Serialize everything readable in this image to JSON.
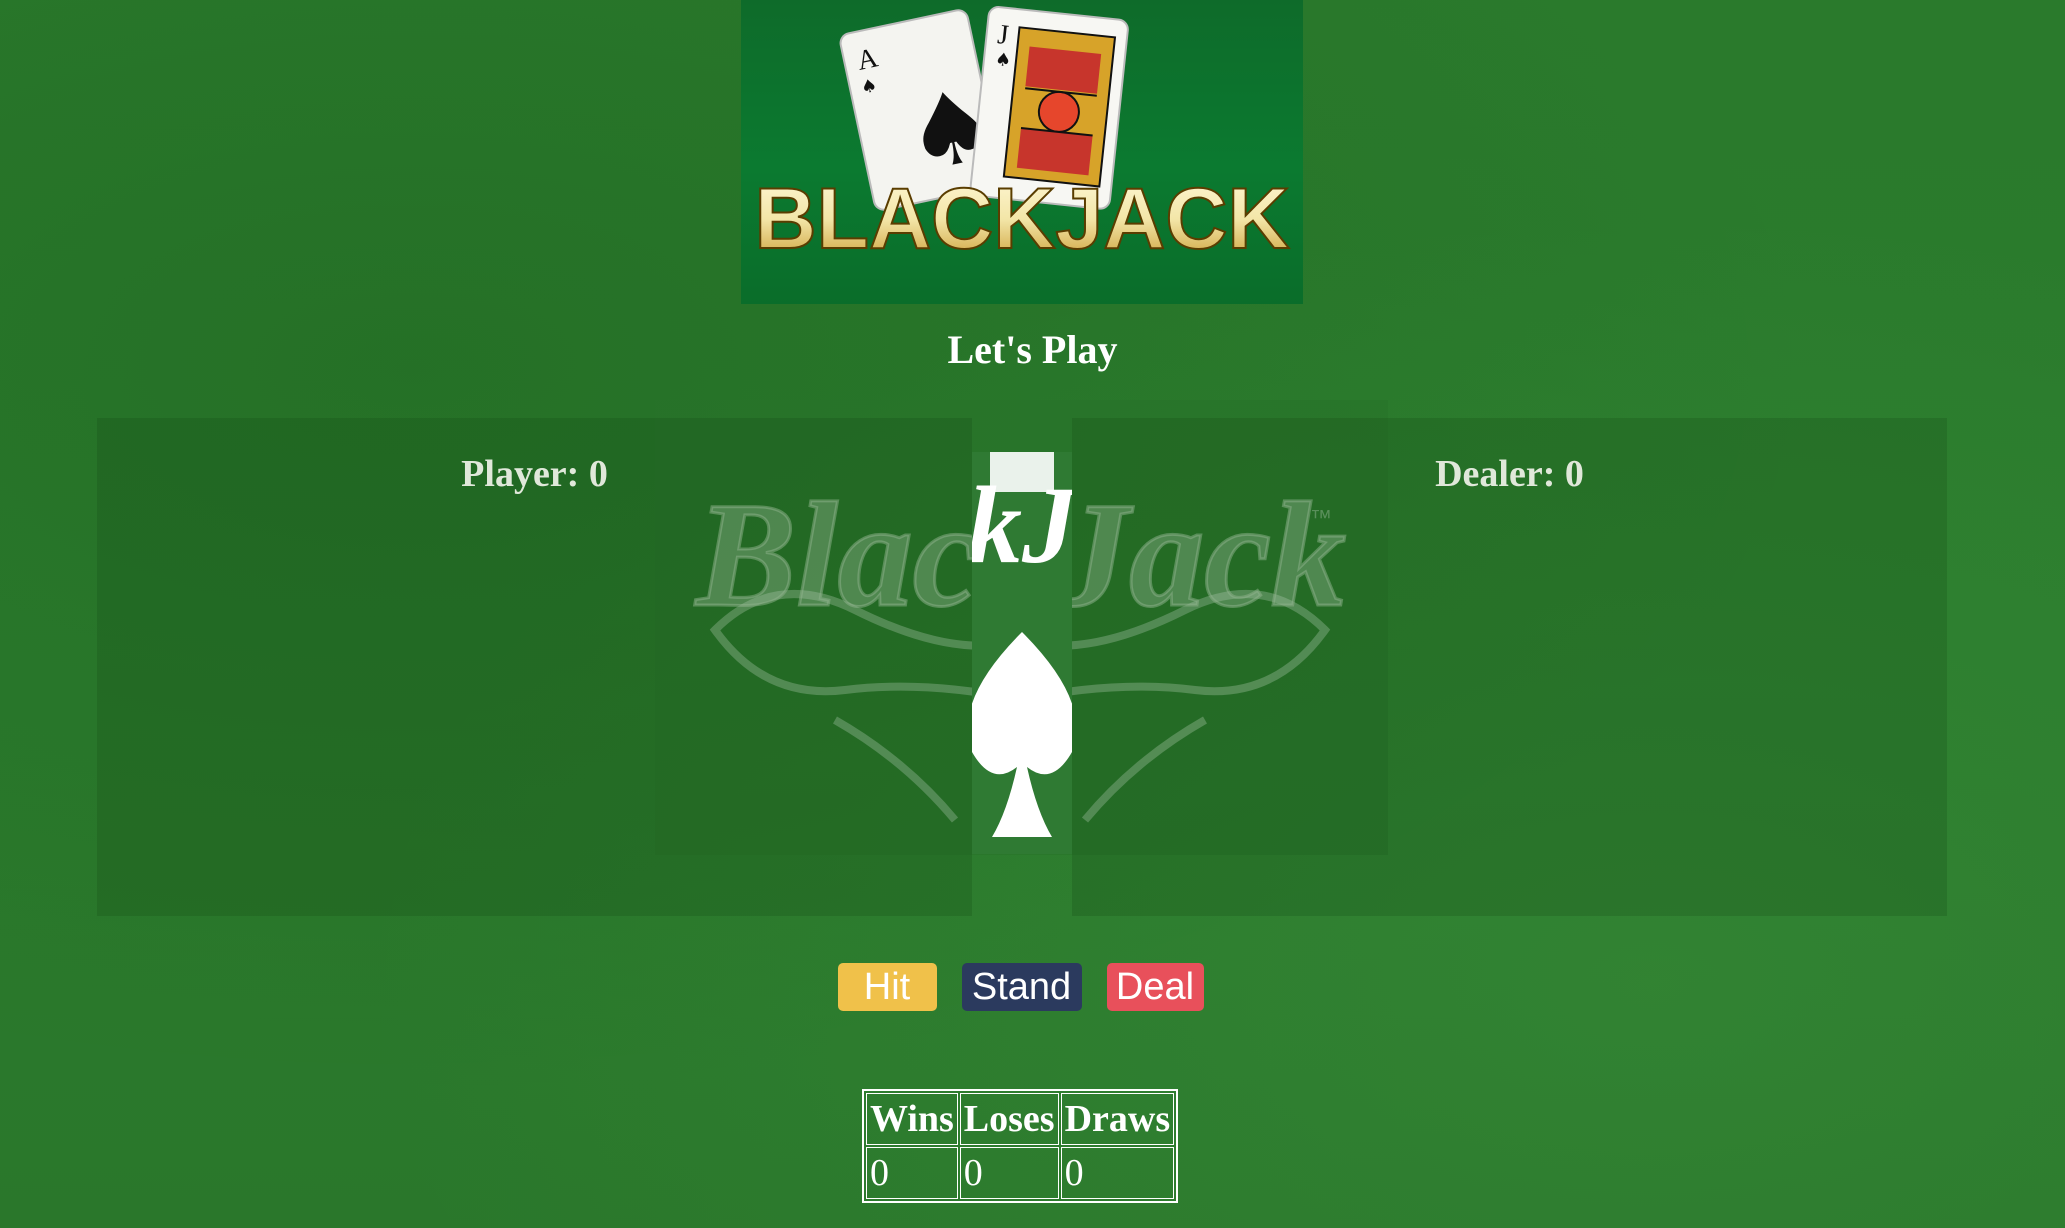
{
  "header": {
    "logo_text": "BLACKJACK",
    "card_left_rank": "A",
    "card_right_rank": "J",
    "subtitle": "Let's Play"
  },
  "watermark": {
    "text": "BlackJack",
    "tm": "™"
  },
  "player": {
    "label": "Player: 0"
  },
  "dealer": {
    "label": "Dealer: 0"
  },
  "controls": {
    "hit_label": "Hit",
    "stand_label": "Stand",
    "deal_label": "Deal"
  },
  "scoreboard": {
    "headers": [
      "Wins",
      "Loses",
      "Draws"
    ],
    "values": [
      "0",
      "0",
      "0"
    ]
  },
  "colors": {
    "felt": "#2b7c2d",
    "hit": "#f0c14a",
    "stand": "#2b3a5e",
    "deal": "#e8505b"
  }
}
